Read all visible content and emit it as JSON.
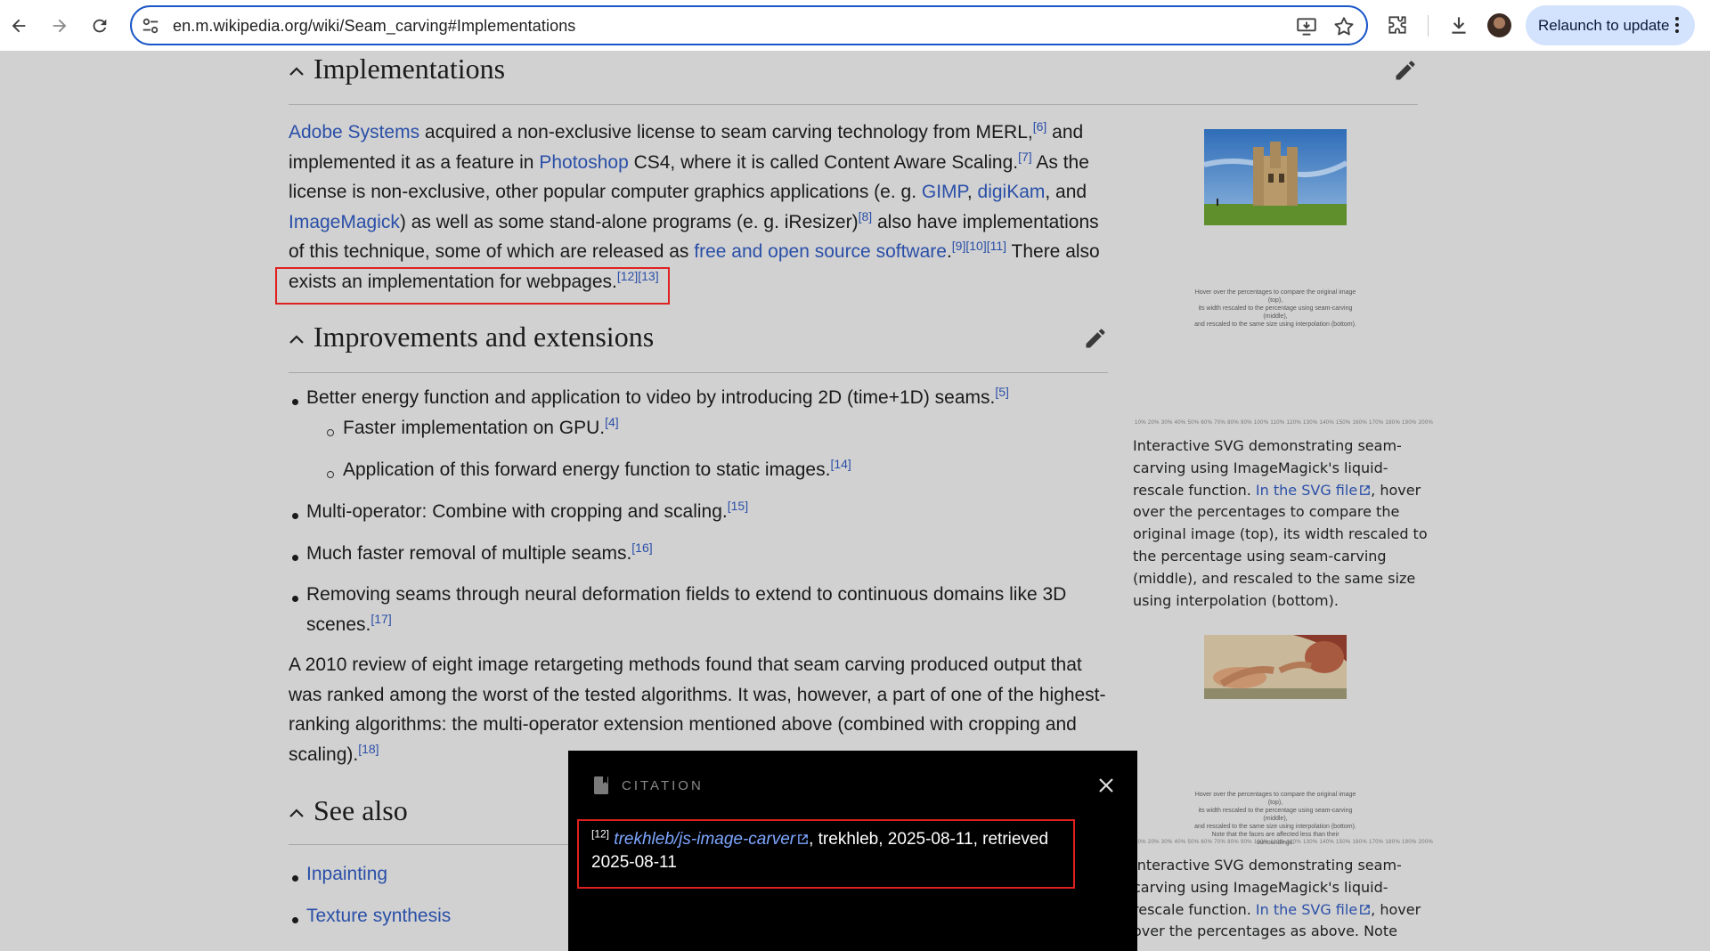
{
  "browser": {
    "url": "en.m.wikipedia.org/wiki/Seam_carving#Implementations",
    "relaunch_label": "Relaunch to update",
    "icons": [
      "back-icon",
      "forward-icon",
      "reload-icon",
      "site-settings-icon",
      "install-app-icon",
      "bookmark-star-icon",
      "extensions-icon",
      "download-icon",
      "more-vert-icon"
    ]
  },
  "sections": {
    "implementations": {
      "title": "Implementations",
      "para": {
        "t1_link": "Adobe Systems",
        "t2": " acquired a non-exclusive license to seam carving technology from MERL,",
        "ref6": "[6]",
        "t3": " and implemented it as a feature in ",
        "t4_link": "Photoshop",
        "t5": " CS4, where it is called Content Aware Scaling.",
        "ref7": "[7]",
        "t6": " As the license is non-exclusive, other popular computer graphics applications (e. g. ",
        "t7_link": "GIMP",
        "t8": ", ",
        "t9_link": "digiKam",
        "t10": ", and ",
        "t11_link": "ImageMagick",
        "t12": ") as well as some stand-alone programs (e. g. iResizer)",
        "ref8": "[8]",
        "t13": " also have implementations of this technique, some of which are released as ",
        "t14_link": "free and open source software",
        "t15": ".",
        "ref9": "[9]",
        "ref10": "[10]",
        "ref11": "[11]",
        "t16": " There also exists an implementation for webpages.",
        "ref12": "[12]",
        "ref13": "[13]"
      }
    },
    "improvements": {
      "title": "Improvements and extensions",
      "items": [
        {
          "text": "Better energy function and application to video by introducing 2D (time+1D) seams.",
          "ref": "[5]"
        },
        {
          "text": "Faster implementation on GPU.",
          "ref": "[4]"
        },
        {
          "text": "Application of this forward energy function to static images.",
          "ref": "[14]"
        },
        {
          "text": "Multi-operator: Combine with cropping and scaling.",
          "ref": "[15]"
        },
        {
          "text": "Much faster removal of multiple seams.",
          "ref": "[16]"
        },
        {
          "text": "Removing seams through neural deformation fields to extend to continuous domains like 3D",
          "text2": "scenes.",
          "ref": "[17]"
        }
      ],
      "review": {
        "l1": "A 2010 review of eight image retargeting methods found that seam carving produced output that",
        "l2": "was ranked among the worst of the tested algorithms. It was, however, a part of one of the highest-",
        "l3": "ranking algorithms: the multi-operator extension mentioned above (combined with cropping and",
        "l4": "scaling).",
        "ref": "[18]"
      }
    },
    "see_also": {
      "title": "See also",
      "items": [
        "Inpainting",
        "Texture synthesis"
      ]
    }
  },
  "sidebar": {
    "tiny1": [
      "Hover over the percentages to compare the original image (top),",
      "its width rescaled to the percentage using seam-carving (middle),",
      "and rescaled to the same size using interpolation (bottom)."
    ],
    "scale": "10% 20% 30% 40% 50% 60% 70% 80% 90% 100% 110% 120% 130% 140% 150% 160% 170% 180% 190% 200%",
    "caption1": {
      "l1": "Interactive SVG demonstrating seam-",
      "l2": "carving using ImageMagick's liquid-",
      "l3a": "rescale function. ",
      "l3_link": "In the SVG file",
      "l3b": ", hover",
      "l4": "over the percentages to compare the",
      "l5": "original image (top), its width rescaled to",
      "l6": "the percentage using seam-carving",
      "l7": "(middle), and rescaled to the same size",
      "l8": "using interpolation (bottom)."
    },
    "tiny2": [
      "Hover over the percentages to compare the original image (top),",
      "its width rescaled to the percentage using seam-carving (middle),",
      "and rescaled to the same size using interpolation (bottom).",
      "Note that the faces are affected less than their surroundings."
    ],
    "caption2": {
      "l1": "Interactive SVG demonstrating seam-",
      "l2": "carving using ImageMagick's liquid-",
      "l3a": "rescale function. ",
      "l3_link": "In the SVG file",
      "l3b": ", hover",
      "l4": "over the percentages as above. Note"
    }
  },
  "citation": {
    "label": "CITATION",
    "ref": "[12]",
    "link": "trekhleb/js-image-carver",
    "rest": ", trekhleb, 2025-08-11, retrieved",
    "line2": "2025-08-11"
  },
  "colors": {
    "link": "#2a4fa8",
    "highlight": "#e02020",
    "omnibox_border": "#1a56c7",
    "relaunch_bg": "#d3e3fd"
  }
}
